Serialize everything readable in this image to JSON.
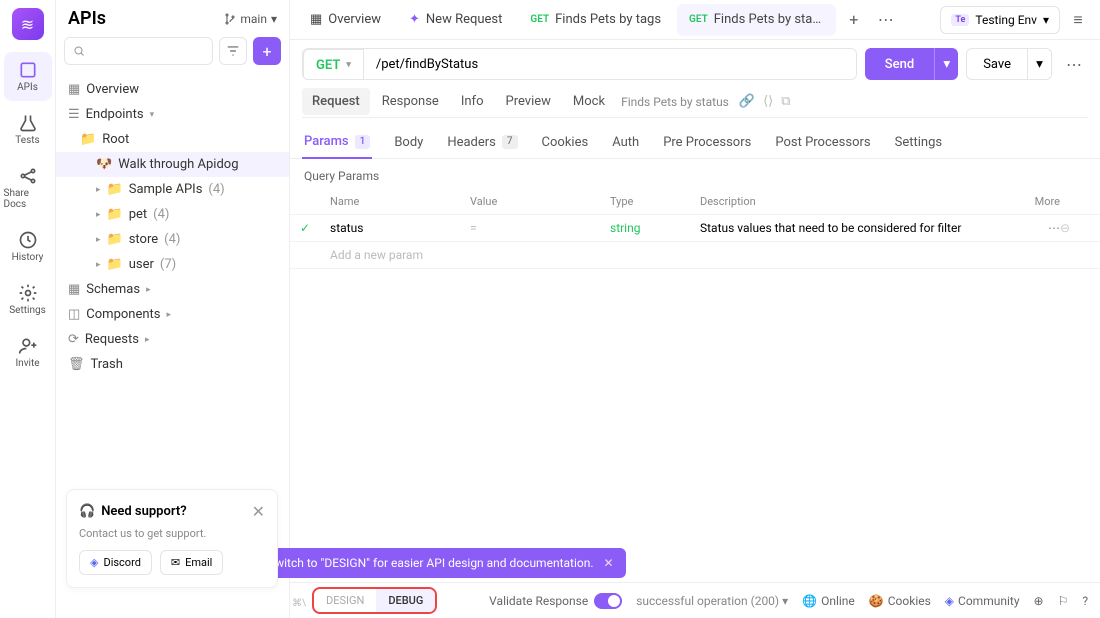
{
  "rail": {
    "items": [
      {
        "label": "APIs"
      },
      {
        "label": "Tests"
      },
      {
        "label": "Share Docs"
      },
      {
        "label": "History"
      },
      {
        "label": "Settings"
      },
      {
        "label": "Invite"
      }
    ]
  },
  "sidebar": {
    "title": "APIs",
    "branch": "main",
    "tree": {
      "overview": "Overview",
      "endpoints": "Endpoints",
      "root": "Root",
      "walk": "Walk through Apidog",
      "sample": "Sample APIs",
      "sample_count": "(4)",
      "pet": "pet",
      "pet_count": "(4)",
      "store": "store",
      "store_count": "(4)",
      "user": "user",
      "user_count": "(7)",
      "schemas": "Schemas",
      "components": "Components",
      "requests": "Requests",
      "trash": "Trash"
    }
  },
  "tabs": {
    "overview": "Overview",
    "new_request": "New Request",
    "get1": "GET",
    "t1": "Finds Pets by tags",
    "get2": "GET",
    "t2": "Finds Pets by stat...",
    "env_chip": "Te",
    "env": "Testing Env"
  },
  "url": {
    "method": "GET",
    "value": "/pet/findByStatus",
    "send": "Send",
    "save": "Save"
  },
  "subtabs": {
    "request": "Request",
    "response": "Response",
    "info": "Info",
    "preview": "Preview",
    "mock": "Mock",
    "crumb": "Finds Pets by status"
  },
  "ptabs": {
    "params": "Params",
    "params_n": "1",
    "body": "Body",
    "headers": "Headers",
    "headers_n": "7",
    "cookies": "Cookies",
    "auth": "Auth",
    "pre": "Pre Processors",
    "post": "Post Processors",
    "settings": "Settings"
  },
  "params": {
    "section": "Query Params",
    "h_name": "Name",
    "h_value": "Value",
    "h_type": "Type",
    "h_desc": "Description",
    "h_more": "More",
    "row": {
      "name": "status",
      "eq": "=",
      "type": "string",
      "desc": "Status values that need to be considered for filter"
    },
    "placeholder": "Add a new param"
  },
  "tip": {
    "text": "Switch to \"DESIGN\" for easier API design and documentation."
  },
  "toggle": {
    "design": "DESIGN",
    "debug": "DEBUG",
    "kbd": "⌘\\"
  },
  "bottom": {
    "validate": "Validate Response",
    "success": "successful operation (200)",
    "online": "Online",
    "cookies": "Cookies",
    "community": "Community"
  },
  "support": {
    "title": "Need support?",
    "sub": "Contact us to get support.",
    "discord": "Discord",
    "email": "Email"
  }
}
